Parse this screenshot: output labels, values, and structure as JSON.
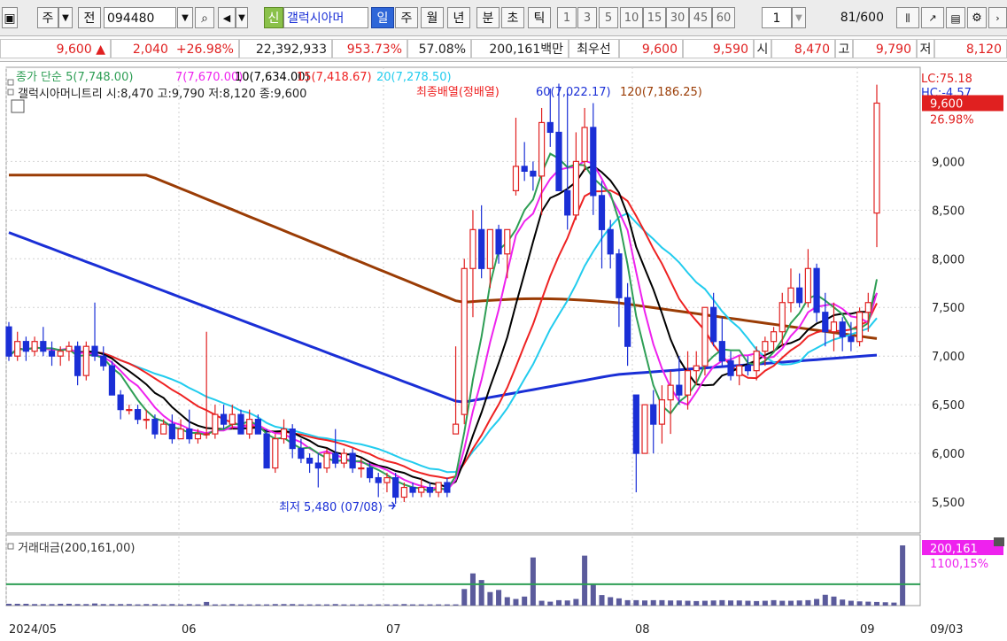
{
  "toolbar": {
    "side_label": "주",
    "prev_label": "전",
    "code": "094480",
    "name": "갤럭시아머",
    "new_badge": "신",
    "periods": [
      "일",
      "주",
      "월",
      "년",
      "분",
      "초",
      "틱"
    ],
    "active_period": "일",
    "intervals": [
      "1",
      "3",
      "5",
      "10",
      "15",
      "30",
      "45",
      "60"
    ],
    "count_value": "1",
    "page_value": "81",
    "page_total": "/600"
  },
  "quote": {
    "price": "9,600",
    "arrow": "▲",
    "change": "2,040",
    "change_pct": "+26.98%",
    "volume": "22,392,933",
    "vol_ratio": "953.73%",
    "turnover": "57.08%",
    "amount": "200,161백만",
    "best_label": "최우선",
    "ask": "9,600",
    "bid": "9,590",
    "open_label": "시",
    "open": "8,470",
    "high_label": "고",
    "high": "9,790",
    "low_label": "저",
    "low": "8,120"
  },
  "colors": {
    "up": "#e02020",
    "down": "#1a2fd6",
    "ma5": "#2e9e55",
    "ma7": "#ee22ee",
    "ma10": "#000000",
    "ma15": "#ee2222",
    "ma20": "#22ccee",
    "ma60": "#1a2fd6",
    "ma120": "#9a3c05",
    "vol": "#5b5b9c",
    "volma": "#2e9e55"
  },
  "chart_data": [
    {
      "type": "candlestick",
      "title": "갤럭시아머니트리 시:8,470 고:9,790 저:8,120 종:9,600",
      "legend": [
        {
          "label": "종가 단순 5(7,748.00)",
          "color": "#2e9e55"
        },
        {
          "label": "7(7,670.00)",
          "color": "#ee22ee"
        },
        {
          "label": "10(7,634.00)",
          "color": "#000000"
        },
        {
          "label": "15(7,418.67)",
          "color": "#ee2222"
        },
        {
          "label": "20(7,278.50)",
          "color": "#22ccee"
        },
        {
          "label": "최종배열(정배열)",
          "color": "#ee2222"
        },
        {
          "label": "60(7,022.17)",
          "color": "#1a2fd6"
        },
        {
          "label": "120(7,186.25)",
          "color": "#9a3c05"
        }
      ],
      "ylim": [
        5200,
        9950
      ],
      "y_ticks": [
        "5,500",
        "6,000",
        "6,500",
        "7,000",
        "7,500",
        "8,000",
        "8,500",
        "9,000"
      ],
      "right_labels": [
        "LC:75.18",
        "HC:-4.57"
      ],
      "last_price": "9,600",
      "last_pct": "26.98%",
      "annotation": "최저 5,480 (07/08)",
      "x_ticks": [
        "2024/05",
        "06",
        "07",
        "08",
        "09",
        "09/03"
      ],
      "candles": [
        [
          7300,
          7350,
          6950,
          7000
        ],
        [
          7000,
          7250,
          6950,
          7150
        ],
        [
          7150,
          7200,
          6950,
          7050
        ],
        [
          7050,
          7200,
          7000,
          7150
        ],
        [
          7150,
          7300,
          7000,
          7050
        ],
        [
          7050,
          7150,
          6900,
          7000
        ],
        [
          7000,
          7100,
          6900,
          7050
        ],
        [
          7050,
          7150,
          6950,
          7100
        ],
        [
          7100,
          7150,
          6700,
          6800
        ],
        [
          6800,
          7150,
          6750,
          7100
        ],
        [
          7100,
          7550,
          6950,
          7000
        ],
        [
          7000,
          7100,
          6850,
          6900
        ],
        [
          6900,
          6950,
          6600,
          6600
        ],
        [
          6600,
          6650,
          6350,
          6450
        ],
        [
          6450,
          6500,
          6400,
          6450
        ],
        [
          6450,
          6500,
          6300,
          6350
        ],
        [
          6350,
          6450,
          6250,
          6350
        ],
        [
          6350,
          6400,
          6150,
          6200
        ],
        [
          6200,
          6350,
          6200,
          6300
        ],
        [
          6300,
          6400,
          6100,
          6150
        ],
        [
          6150,
          6350,
          6150,
          6250
        ],
        [
          6250,
          6450,
          6100,
          6150
        ],
        [
          6150,
          6250,
          6100,
          6200
        ],
        [
          6200,
          7250,
          6150,
          6200
        ],
        [
          6200,
          6500,
          6150,
          6400
        ],
        [
          6400,
          6500,
          6250,
          6300
        ],
        [
          6300,
          6500,
          6250,
          6400
        ],
        [
          6400,
          6450,
          6200,
          6200
        ],
        [
          6200,
          6450,
          6150,
          6350
        ],
        [
          6350,
          6400,
          6200,
          6200
        ],
        [
          6200,
          6250,
          5850,
          5850
        ],
        [
          5850,
          6200,
          5800,
          6150
        ],
        [
          6150,
          6350,
          6100,
          6250
        ],
        [
          6250,
          6300,
          5950,
          6050
        ],
        [
          6050,
          6150,
          5900,
          5950
        ],
        [
          5950,
          6000,
          5800,
          5900
        ],
        [
          5900,
          6000,
          5650,
          5850
        ],
        [
          5850,
          6050,
          5800,
          6000
        ],
        [
          6000,
          6250,
          5850,
          5900
        ],
        [
          5900,
          6050,
          5850,
          6000
        ],
        [
          6000,
          6050,
          5800,
          5850
        ],
        [
          5850,
          5950,
          5750,
          5850
        ],
        [
          5850,
          5900,
          5700,
          5750
        ],
        [
          5750,
          5800,
          5550,
          5700
        ],
        [
          5700,
          5800,
          5600,
          5750
        ],
        [
          5750,
          5800,
          5480,
          5550
        ],
        [
          5550,
          5700,
          5500,
          5650
        ],
        [
          5650,
          5700,
          5550,
          5600
        ],
        [
          5600,
          5750,
          5550,
          5650
        ],
        [
          5650,
          5700,
          5550,
          5600
        ],
        [
          5600,
          5700,
          5550,
          5700
        ],
        [
          5700,
          5750,
          5550,
          5600
        ],
        [
          6200,
          7100,
          6200,
          6300
        ],
        [
          6400,
          8000,
          6300,
          7900
        ],
        [
          7900,
          8500,
          7400,
          8300
        ],
        [
          8300,
          8550,
          7800,
          7900
        ],
        [
          7900,
          8300,
          7700,
          8300
        ],
        [
          8300,
          8350,
          7950,
          8050
        ],
        [
          8050,
          8300,
          7800,
          8300
        ],
        [
          8700,
          9450,
          8650,
          8950
        ],
        [
          8950,
          9200,
          8800,
          8900
        ],
        [
          8900,
          9000,
          8700,
          8850
        ],
        [
          8850,
          9550,
          8450,
          9400
        ],
        [
          9400,
          9750,
          9150,
          9300
        ],
        [
          9300,
          9800,
          8700,
          8700
        ],
        [
          8700,
          9700,
          8300,
          8450
        ],
        [
          8450,
          9300,
          8400,
          9000
        ],
        [
          9000,
          9550,
          8900,
          9350
        ],
        [
          9350,
          9600,
          8450,
          8650
        ],
        [
          8650,
          8800,
          7900,
          8300
        ],
        [
          8300,
          8400,
          7900,
          8050
        ],
        [
          8050,
          8100,
          7300,
          7600
        ],
        [
          7600,
          7750,
          6900,
          7100
        ],
        [
          6600,
          6600,
          5600,
          6000
        ],
        [
          6000,
          6300,
          6050,
          6500
        ],
        [
          6500,
          6650,
          6000,
          6300
        ],
        [
          6300,
          6700,
          6100,
          6550
        ],
        [
          6550,
          6850,
          6200,
          6700
        ],
        [
          6700,
          7000,
          6500,
          6600
        ],
        [
          6600,
          7050,
          6450,
          6850
        ],
        [
          6850,
          7050,
          6700,
          6900
        ],
        [
          6900,
          7500,
          6800,
          7500
        ],
        [
          7500,
          7650,
          7100,
          7150
        ],
        [
          7150,
          7400,
          6900,
          6950
        ],
        [
          6950,
          7050,
          6750,
          6800
        ],
        [
          6800,
          7000,
          6700,
          6900
        ],
        [
          6900,
          7000,
          6800,
          6850
        ],
        [
          6850,
          7100,
          6750,
          7050
        ],
        [
          7050,
          7200,
          6900,
          7150
        ],
        [
          7150,
          7300,
          7050,
          7250
        ],
        [
          7250,
          7650,
          7100,
          7550
        ],
        [
          7550,
          7900,
          7450,
          7700
        ],
        [
          7700,
          7850,
          7500,
          7550
        ],
        [
          7550,
          8100,
          7500,
          7900
        ],
        [
          7900,
          7950,
          7350,
          7450
        ],
        [
          7450,
          7650,
          7100,
          7250
        ],
        [
          7250,
          7550,
          7050,
          7350
        ],
        [
          7350,
          7400,
          7050,
          7200
        ],
        [
          7200,
          7350,
          7050,
          7150
        ],
        [
          7150,
          7500,
          7100,
          7450
        ],
        [
          7450,
          7650,
          7250,
          7550
        ],
        [
          8470,
          9790,
          8120,
          9600
        ]
      ]
    },
    {
      "type": "bar",
      "title": "거래대금(200,161,00)",
      "last_value": "200,161",
      "last_pct": "1100,15%",
      "ylim": [
        0,
        200161
      ],
      "values": [
        6000,
        6000,
        6000,
        5000,
        5000,
        5000,
        6000,
        6000,
        5000,
        5000,
        7000,
        5000,
        5000,
        5000,
        5000,
        4000,
        5000,
        5000,
        4000,
        5000,
        4000,
        5000,
        4000,
        12000,
        4000,
        4000,
        5000,
        4000,
        4000,
        4000,
        4000,
        5000,
        5000,
        5000,
        4000,
        4000,
        4000,
        4000,
        5000,
        4000,
        4000,
        4000,
        4000,
        4000,
        4000,
        4000,
        5000,
        4000,
        4000,
        4000,
        4000,
        4000,
        4000,
        55000,
        107000,
        85000,
        45000,
        52000,
        28000,
        22000,
        30000,
        160000,
        16000,
        13000,
        18000,
        17000,
        22000,
        166000,
        70000,
        35000,
        28000,
        24000,
        18000,
        18000,
        17000,
        18000,
        18000,
        17000,
        17000,
        16000,
        15000,
        16000,
        17000,
        18000,
        17000,
        17000,
        16000,
        15000,
        16000,
        18000,
        16000,
        16000,
        17000,
        18000,
        22000,
        36000,
        30000,
        20000,
        16000,
        14000,
        13000,
        12000,
        11000,
        10000,
        200161
      ],
      "avg_line": 71000
    }
  ]
}
